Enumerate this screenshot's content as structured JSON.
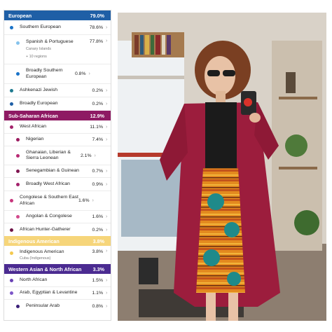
{
  "ancestry": {
    "sections": [
      {
        "header": {
          "label": "European",
          "percent": "79.0%",
          "color": "#1f5fa6"
        },
        "rows": [
          {
            "label": "Southern European",
            "percent": "78.6%",
            "color": "#1a73c8",
            "indent": 0
          },
          {
            "label": "Spanish & Portuguese",
            "percent": "77.8%",
            "color": "#86c3ec",
            "indent": 1,
            "note1": "Canary Islands",
            "note2": "+ 10 regions"
          },
          {
            "label": "Broadly Southern European",
            "percent": "0.8%",
            "color": "#1a73c8",
            "indent": 1
          },
          {
            "label": "Ashkenazi Jewish",
            "percent": "0.2%",
            "color": "#1e7a8f",
            "indent": 0
          },
          {
            "label": "Broadly European",
            "percent": "0.2%",
            "color": "#1f5fa6",
            "indent": 0
          }
        ]
      },
      {
        "header": {
          "label": "Sub-Saharan African",
          "percent": "12.9%",
          "color": "#8e1a63"
        },
        "rows": [
          {
            "label": "West African",
            "percent": "11.1%",
            "color": "#a3226c",
            "indent": 0
          },
          {
            "label": "Nigerian",
            "percent": "7.4%",
            "color": "#9b1b5f",
            "indent": 1
          },
          {
            "label": "Ghanaian, Liberian & Sierra Leonean",
            "percent": "2.1%",
            "color": "#b82a74",
            "indent": 1
          },
          {
            "label": "Senegambian & Guinean",
            "percent": "0.7%",
            "color": "#7f1550",
            "indent": 1
          },
          {
            "label": "Broadly West African",
            "percent": "0.9%",
            "color": "#a3226c",
            "indent": 1
          },
          {
            "label": "Congolese & Southern East African",
            "percent": "1.6%",
            "color": "#c7357c",
            "indent": 0
          },
          {
            "label": "Angolan & Congolese",
            "percent": "1.6%",
            "color": "#d24a8c",
            "indent": 1
          },
          {
            "label": "African Hunter-Gatherer",
            "percent": "0.2%",
            "color": "#6d1346",
            "indent": 0
          }
        ]
      },
      {
        "header": {
          "label": "Indigenous American",
          "percent": "3.8%",
          "color": "#f6d57a"
        },
        "rows": [
          {
            "label": "Indigenous American",
            "percent": "3.8%",
            "color": "#f4c94f",
            "indent": 0,
            "note1": "Cuba (Indigenous)"
          }
        ]
      },
      {
        "header": {
          "label": "Western Asian & North African",
          "percent": "3.3%",
          "color": "#4b2b91"
        },
        "rows": [
          {
            "label": "North African",
            "percent": "1.5%",
            "color": "#6a42b5",
            "indent": 0
          },
          {
            "label": "Arab, Egyptian & Levantine",
            "percent": "1.1%",
            "color": "#7d56c8",
            "indent": 0
          },
          {
            "label": "Peninsular Arab",
            "percent": "0.8%",
            "color": "#3b1f78",
            "indent": 1
          }
        ]
      }
    ]
  }
}
